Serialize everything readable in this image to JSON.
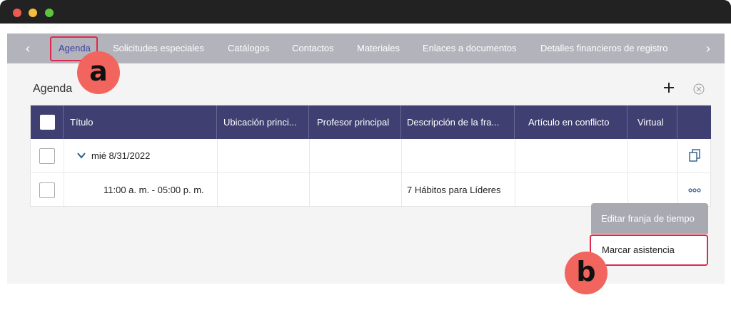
{
  "tabs": {
    "items": [
      {
        "label": "Agenda"
      },
      {
        "label": "Solicitudes especiales"
      },
      {
        "label": "Catálogos"
      },
      {
        "label": "Contactos"
      },
      {
        "label": "Materiales"
      },
      {
        "label": "Enlaces a documentos"
      },
      {
        "label": "Detalles financieros de registro"
      }
    ],
    "prev_icon": "chevron-left-icon",
    "next_icon": "chevron-right-icon"
  },
  "badges": {
    "a": "a",
    "b": "b"
  },
  "section": {
    "title": "Agenda",
    "add_icon": "plus-icon",
    "close_icon": "circle-x-icon"
  },
  "table": {
    "columns": [
      "Título",
      "Ubicación princi...",
      "Profesor principal",
      "Descripción de la fra...",
      "Artículo en conflicto",
      "Virtual"
    ],
    "rows": [
      {
        "title": "mié 8/31/2022",
        "description": "",
        "action_icon": "copy-icon"
      },
      {
        "title": "11:00 a. m. - 05:00 p. m.",
        "description": "7 Hábitos para Líderes",
        "action_icon": "more-icon"
      }
    ]
  },
  "menu": {
    "items": [
      {
        "label": "Editar franja de tiempo"
      },
      {
        "label": "Marcar asistencia"
      }
    ]
  },
  "colors": {
    "header": "#403f72",
    "highlight": "#e0284f",
    "badge": "#f2655e",
    "active_tab": "#3b3fa0"
  }
}
